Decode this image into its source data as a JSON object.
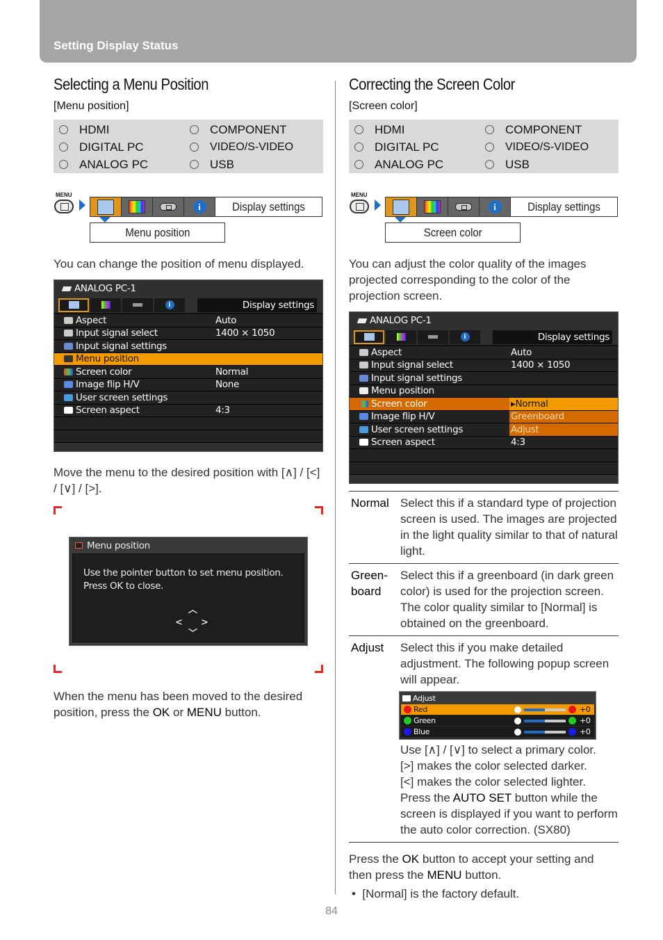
{
  "header": {
    "title": "Setting Display Status"
  },
  "inputs": [
    {
      "label": "HDMI"
    },
    {
      "label": "COMPONENT"
    },
    {
      "label": "DIGITAL PC"
    },
    {
      "label": "VIDEO/S-VIDEO"
    },
    {
      "label": "ANALOG PC"
    },
    {
      "label": "USB"
    }
  ],
  "left": {
    "title": "Selecting a Menu Position",
    "subtitle": "[Menu position]",
    "nav": {
      "menu_label": "MENU",
      "tab_label": "Display settings",
      "sub_label": "Menu position"
    },
    "intro": "You can change the position of menu displayed.",
    "instruction": "Move the menu to the desired position with [∧] / [<] / [∨] / [>].",
    "dialog": {
      "title": "Menu position",
      "line1": "Use the pointer button to set menu position.",
      "line2": "Press OK to close.",
      "arrows": {
        "up": "︿",
        "down": "﹀",
        "left": "<",
        "right": ">"
      }
    },
    "final_pre": "When the menu has been moved to the desired position, press the ",
    "final_ok": "OK",
    "final_mid": " or ",
    "final_menu": "MENU",
    "final_post": " button."
  },
  "osd": {
    "source": "ANALOG PC-1",
    "tab_label": "Display settings",
    "rows": [
      {
        "name": "Aspect",
        "value": "Auto"
      },
      {
        "name": "Input signal select",
        "value": "1400 × 1050"
      },
      {
        "name": "Input signal settings",
        "value": ""
      },
      {
        "name": "Menu position",
        "value": ""
      },
      {
        "name": "Screen color",
        "value": "Normal"
      },
      {
        "name": "Image flip H/V",
        "value": "None"
      },
      {
        "name": "User screen settings",
        "value": ""
      },
      {
        "name": "Screen aspect",
        "value": "4:3"
      }
    ],
    "screen_color_options": [
      "▸Normal",
      "Greenboard",
      "Adjust"
    ]
  },
  "right": {
    "title": "Correcting the Screen Color",
    "subtitle": "[Screen color]",
    "nav": {
      "menu_label": "MENU",
      "tab_label": "Display settings",
      "sub_label": "Screen color"
    },
    "intro": "You can adjust the color quality of the images projected corresponding to the color of the projection screen.",
    "options": [
      {
        "key": "Normal",
        "desc": "Select this if a standard type of projection screen is used. The images are projected in the light quality similar to that of natural light."
      },
      {
        "key": "Green-board",
        "desc": "Select this if a greenboard (in dark green color) is used for the projection screen. The color quality similar to [Normal] is obtained on the greenboard."
      },
      {
        "key": "Adjust",
        "desc": "Select this if you make detailed adjustment. The following popup screen will appear."
      }
    ],
    "adjust_popup": {
      "title": "Adjust",
      "rows": [
        {
          "name": "Red",
          "color": "#e8141e",
          "value": "+0",
          "level": 0.5
        },
        {
          "name": "Green",
          "color": "#22cc22",
          "value": "+0",
          "level": 0.5
        },
        {
          "name": "Blue",
          "color": "#1a1aee",
          "value": "+0",
          "level": 0.5
        }
      ]
    },
    "adjust_help": [
      "Use [∧] / [∨] to select a primary color.",
      "[>] makes the color selected darker.",
      "[<] makes the color selected lighter."
    ],
    "adjust_autoset_pre": "Press the ",
    "adjust_autoset_btn": "AUTO SET",
    "adjust_autoset_post": " button while the screen is displayed if you want to perform the auto color correction. (SX80)",
    "final_pre": "Press the ",
    "final_ok": "OK",
    "final_mid": " button to accept your setting and then press the ",
    "final_menu": "MENU",
    "final_post": " button.",
    "bullet": "[Normal] is the factory default."
  },
  "page_number": "84"
}
